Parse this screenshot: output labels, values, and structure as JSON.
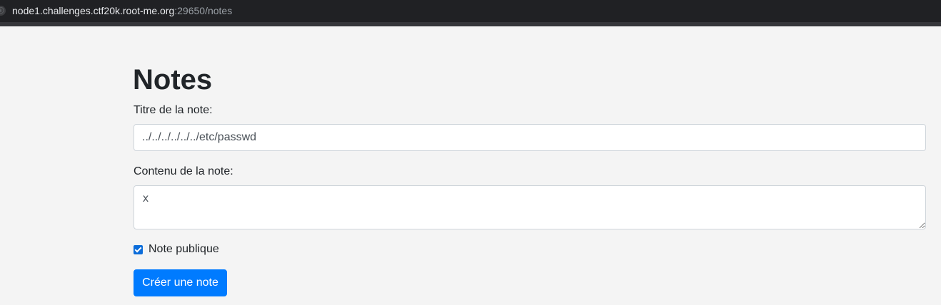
{
  "browser": {
    "url_host": "node1.challenges.ctf20k.root-me.org",
    "url_rest": ":29650/notes",
    "site_icon": "info-icon"
  },
  "page": {
    "title": "Notes"
  },
  "form": {
    "title_label": "Titre de la note:",
    "title_value": "../../../../../../etc/passwd",
    "content_label": "Contenu de la note:",
    "content_value": "x",
    "public_label": "Note publique",
    "public_checked": true,
    "submit_label": "Créer une note"
  },
  "colors": {
    "accent": "#007bff",
    "background": "#f4f4f4",
    "browser_bar": "#202124"
  }
}
